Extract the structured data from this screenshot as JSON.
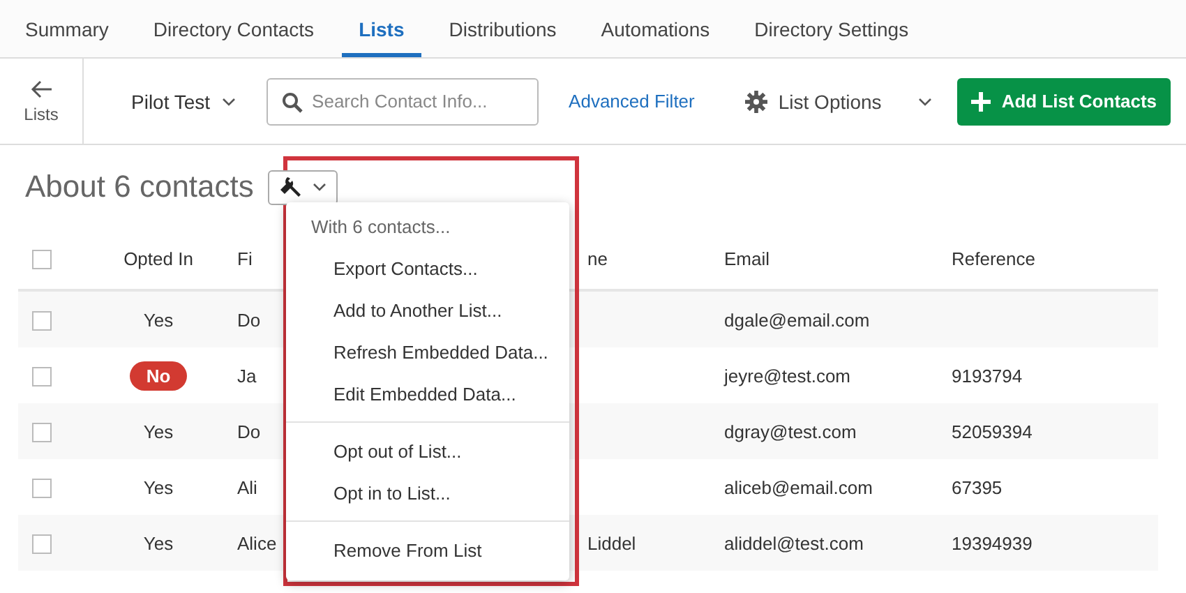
{
  "tabs": [
    {
      "label": "Summary",
      "selected": false
    },
    {
      "label": "Directory Contacts",
      "selected": false
    },
    {
      "label": "Lists",
      "selected": true
    },
    {
      "label": "Distributions",
      "selected": false
    },
    {
      "label": "Automations",
      "selected": false
    },
    {
      "label": "Directory Settings",
      "selected": false
    }
  ],
  "toolbar": {
    "back_label": "Lists",
    "list_name": "Pilot Test",
    "search_placeholder": "Search Contact Info...",
    "advanced_filter": "Advanced Filter",
    "list_options": "List Options",
    "add_button": "Add List Contacts"
  },
  "heading": "About 6 contacts",
  "table": {
    "select_all_checked": false,
    "columns": [
      "Opted In",
      "Fi",
      "ne",
      "Email",
      "Reference"
    ],
    "rows": [
      {
        "checked": false,
        "opted_in": true,
        "opted_label": "Yes",
        "first": "Do",
        "email": "dgale@email.com"
      },
      {
        "checked": false,
        "opted_in": false,
        "opted_label": "No",
        "first": "Ja",
        "email": "jeyre@test.com",
        "reference": "9193794"
      },
      {
        "checked": false,
        "opted_in": true,
        "opted_label": "Yes",
        "first": "Do",
        "email": "dgray@test.com",
        "reference": "52059394"
      },
      {
        "checked": false,
        "opted_in": true,
        "opted_label": "Yes",
        "first": "Ali",
        "email": "aliceb@email.com",
        "reference": "67395"
      },
      {
        "checked": false,
        "opted_in": true,
        "opted_label": "Yes",
        "first": "Alice",
        "last": "Liddel",
        "email": "aliddel@test.com",
        "reference": "19394939"
      }
    ]
  },
  "actions_menu": {
    "header": "With 6 contacts...",
    "groups": [
      [
        "Export Contacts...",
        "Add to Another List...",
        "Refresh Embedded Data...",
        "Edit Embedded Data..."
      ],
      [
        "Opt out of List...",
        "Opt in to List..."
      ],
      [
        "Remove From List"
      ]
    ]
  }
}
